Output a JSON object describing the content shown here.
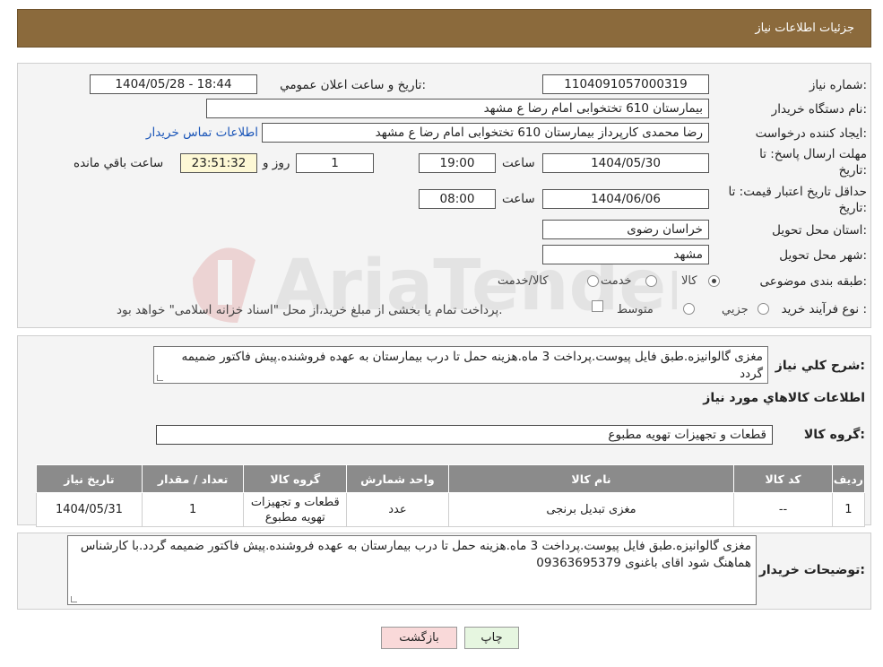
{
  "header": {
    "title": "جزئیات اطلاعات نیاز"
  },
  "form": {
    "need_number_label": "شماره نیاز:",
    "need_number": "1104091057000319",
    "announce_label": "تاريخ و ساعت اعلان عمومي:",
    "announce_value": "1404/05/28 - 18:44",
    "buyer_org_label": "نام دستگاه خريدار:",
    "buyer_org": "بیمارستان 610 تختخوابی امام رضا ع  مشهد",
    "requester_label": "ايجاد کننده درخواست:",
    "requester": "رضا محمدی کارپرداز بیمارستان 610 تختخوابی امام رضا ع  مشهد",
    "contact_link": "اطلاعات تماس خريدار",
    "reply_deadline_label_1": "مهلت ارسال پاسخ: تا",
    "reply_deadline_label_2": "تاريخ:",
    "reply_date": "1404/05/30",
    "time_label": "ساعت",
    "reply_time": "19:00",
    "days_value": "1",
    "days_label": "روز و",
    "remaining_time": "23:51:32",
    "remaining_label": "ساعت باقي مانده",
    "validity_label_1": "حداقل تاريخ اعتبار قيمت: تا",
    "validity_label_2": "تاريخ:",
    "validity_date": "1404/06/06",
    "validity_time": "08:00",
    "province_label": "استان محل تحويل:",
    "province": "خراسان رضوی",
    "city_label": "شهر محل تحويل:",
    "city": "مشهد",
    "category_label": "طبقه بندی موضوعی:",
    "category_options": [
      "کالا",
      "خدمت",
      "کالا/خدمت"
    ],
    "category_selected": "کالا",
    "process_label": "نوع فرآيند خريد :",
    "process_options": [
      "جزيي",
      "متوسط"
    ],
    "process_note": "پرداخت تمام يا بخشی از مبلغ خريد،از محل \"اسناد خزانه اسلامی\" خواهد بود."
  },
  "description": {
    "label": "شرح کلي نياز:",
    "text": "مغزی گالوانیزه.طبق فایل پیوست.پرداخت 3 ماه.هزینه حمل تا درب بیمارستان به عهده فروشنده.پیش فاکتور ضمیمه گردد"
  },
  "goods": {
    "section_title": "اطلاعات کالاهاي مورد نياز",
    "group_label": "گروه کالا:",
    "group_value": "قطعات و تجهیزات تهویه مطبوع",
    "columns": [
      "رديف",
      "کد کالا",
      "نام کالا",
      "واحد شمارش",
      "گروه کالا",
      "تعداد / مقدار",
      "تاريخ نياز"
    ],
    "rows": [
      {
        "row": "1",
        "code": "--",
        "name": "مغزی تبدیل برنجی",
        "unit": "عدد",
        "group": "قطعات و تجهیزات تهویه مطبوع",
        "qty": "1",
        "date": "1404/05/31"
      }
    ]
  },
  "buyer_notes": {
    "label": "توضيحات خريدار:",
    "text": "مغزی گالوانیزه.طبق فایل پیوست.پرداخت 3 ماه.هزینه حمل تا درب بیمارستان به عهده فروشنده.پیش فاکتور ضمیمه گردد.با کارشناس هماهنگ شود اقای باغنوی 09363695379"
  },
  "buttons": {
    "print": "چاپ",
    "back": "بازگشت"
  },
  "colors": {
    "header_bg": "#8b6a3c",
    "table_header_bg": "#8b8b8b",
    "back_bg": "#f9d9d9",
    "print_bg": "#e6f6e0"
  },
  "watermark": {
    "text": "AriaTender.neT"
  }
}
